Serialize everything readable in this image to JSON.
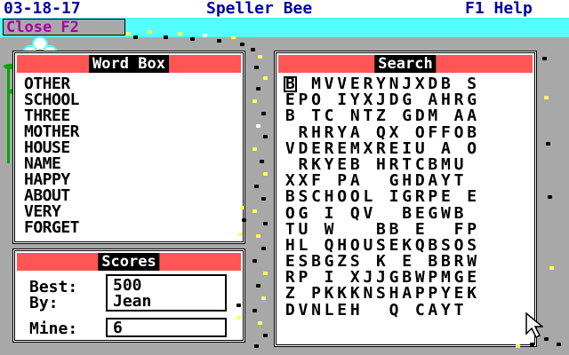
{
  "titlebar": {
    "date": "03-18-17",
    "app_title": "Speller Bee",
    "help": "F1 Help"
  },
  "menubar": {
    "close_label": "Close F2"
  },
  "word_box": {
    "title": "Word Box",
    "words": [
      "OTHER",
      "SCHOOL",
      "THREE",
      "MOTHER",
      "HOUSE",
      "NAME",
      "HAPPY",
      "ABOUT",
      "VERY",
      "FORGET"
    ]
  },
  "scores": {
    "title": "Scores",
    "best_label": "Best:",
    "by_label": "By:",
    "mine_label": "Mine:",
    "best_value": "500",
    "by_value": "Jean",
    "mine_value": "6"
  },
  "search": {
    "title": "Search",
    "rows": [
      "B MVVERYNJXDB S",
      "EPO IYXJDG AHRG",
      "B TC NTZ GDM AA",
      " RHRYA QX OFFOB",
      "VDEREMXREIU A O",
      " RKYEB HRTCBMU ",
      "XXF PA  GHDAYT ",
      "BSCHOOL IGRPE E",
      "OG I QV  BEGWB ",
      "TU W   BB E  FP",
      "HL QHOUSEKQBSOS",
      "ESBGZS K E BBRW",
      "RP I XJJGBWPMGE",
      "Z PKKKNSHAPPYEK",
      "DVNLEH  Q CAYT "
    ]
  },
  "colors": {
    "title_text": "#0000a8",
    "menubar_bg": "#55ffff",
    "close_text": "#a800a8",
    "panel_header": "#ff5555",
    "background": "#a8a8a8"
  }
}
